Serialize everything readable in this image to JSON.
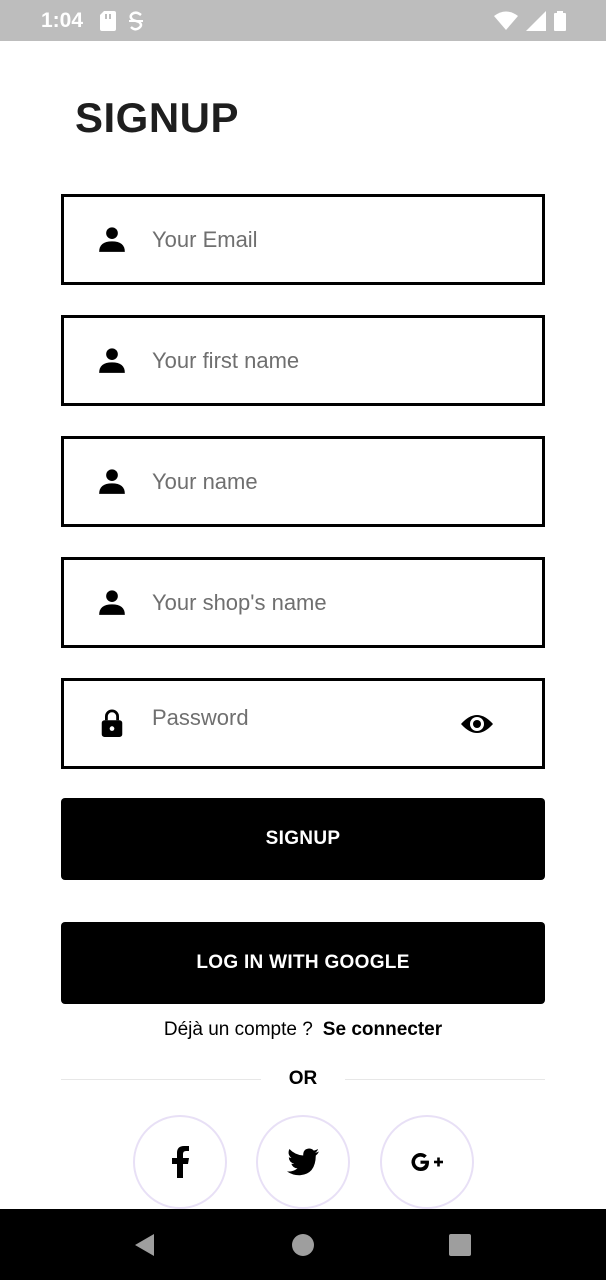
{
  "status_bar": {
    "time": "1:04",
    "left_icons": [
      "sd-card-icon",
      "s-app-icon"
    ],
    "right_icons": [
      "wifi-icon",
      "signal-icon",
      "battery-icon"
    ]
  },
  "page": {
    "title": "SIGNUP"
  },
  "form": {
    "email": {
      "placeholder": "Your Email",
      "value": "",
      "icon": "person-icon"
    },
    "first_name": {
      "placeholder": "Your first name",
      "value": "",
      "icon": "person-icon"
    },
    "name": {
      "placeholder": "Your name",
      "value": "",
      "icon": "person-icon"
    },
    "shop_name": {
      "placeholder": "Your shop's name",
      "value": "",
      "icon": "person-icon"
    },
    "password": {
      "placeholder": "Password",
      "value": "",
      "icon": "lock-icon",
      "toggle_icon": "eye-icon"
    }
  },
  "buttons": {
    "signup_label": "SIGNUP",
    "google_label": "LOG IN WITH GOOGLE"
  },
  "login_prompt": {
    "question": "Déjà un compte ?",
    "link": "Se connecter"
  },
  "divider": {
    "label": "OR"
  },
  "social": {
    "items": [
      "facebook-icon",
      "twitter-icon",
      "google-plus-icon"
    ]
  },
  "navigation": {
    "buttons": [
      "back-icon",
      "home-icon",
      "recents-icon"
    ]
  },
  "colors": {
    "status_bar": "#bdbdbd",
    "primary": "#000000",
    "placeholder": "#6f6f6f",
    "social_border": "#e8e0f6"
  }
}
